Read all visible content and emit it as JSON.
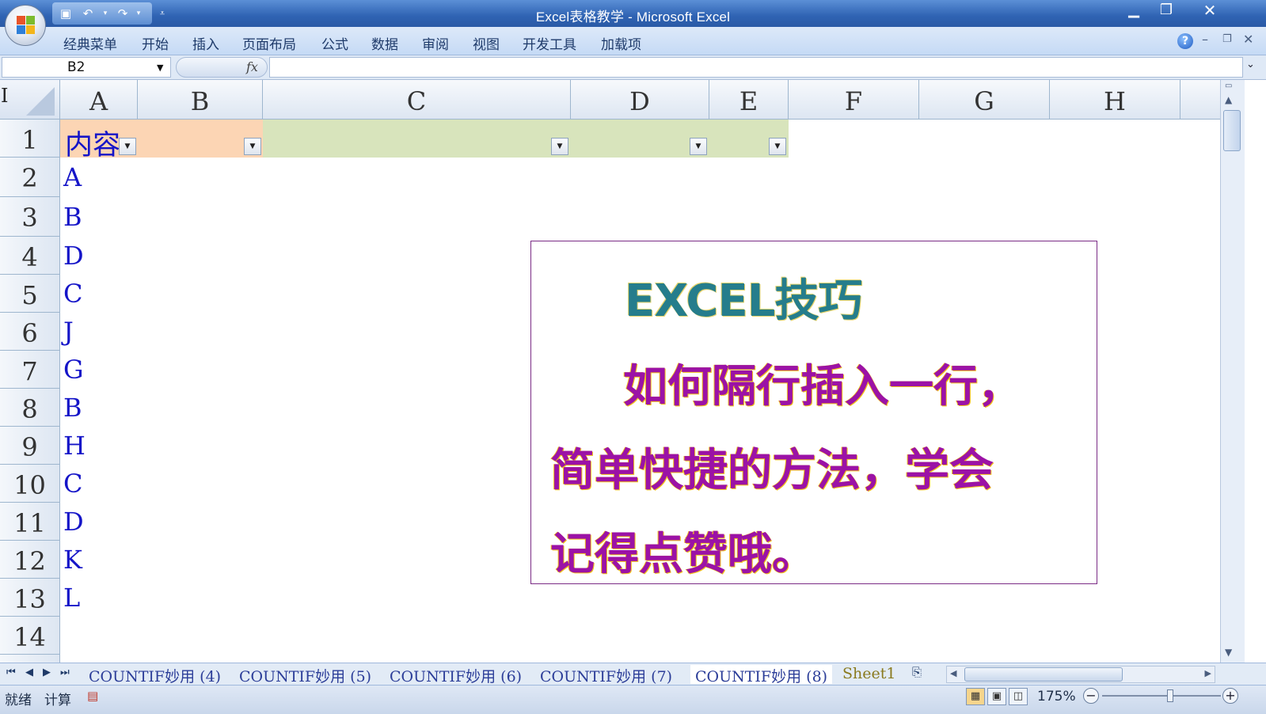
{
  "window": {
    "title": "Excel表格教学 - Microsoft Excel"
  },
  "menu": {
    "items": [
      "经典菜单",
      "开始",
      "插入",
      "页面布局",
      "公式",
      "数据",
      "审阅",
      "视图",
      "开发工具",
      "加载项"
    ]
  },
  "formula_bar": {
    "name_box": "B2",
    "fx": "fx",
    "formula": ""
  },
  "columns": [
    "A",
    "B",
    "C",
    "D",
    "E",
    "F",
    "G",
    "H"
  ],
  "rows": [
    "1",
    "2",
    "3",
    "4",
    "5",
    "6",
    "7",
    "8",
    "9",
    "10",
    "11",
    "12",
    "13",
    "14"
  ],
  "header_cell": {
    "A1": "内容"
  },
  "column_a_values": [
    "A",
    "B",
    "D",
    "C",
    "J",
    "G",
    "B",
    "H",
    "C",
    "D",
    "K",
    "L"
  ],
  "textbox": {
    "title": "EXCEL技巧",
    "line1": "如何隔行插入一行，",
    "line2": "简单快捷的方法，学会",
    "line3": "记得点赞哦。"
  },
  "sheet_tabs": [
    "COUNTIF妙用 (4)",
    "COUNTIF妙用 (5)",
    "COUNTIF妙用 (6)",
    "COUNTIF妙用 (7)",
    "COUNTIF妙用 (8)",
    "Sheet1"
  ],
  "active_tab": "COUNTIF妙用 (8)",
  "status": {
    "ready": "就绪",
    "calc": "计算",
    "zoom": "175%"
  },
  "colors": {
    "header_orange": "#fcd5b4",
    "header_green": "#d8e4bc",
    "cell_text": "#1515c8",
    "textbox_title": "#257d8c",
    "textbox_body": "#9b12a6"
  }
}
